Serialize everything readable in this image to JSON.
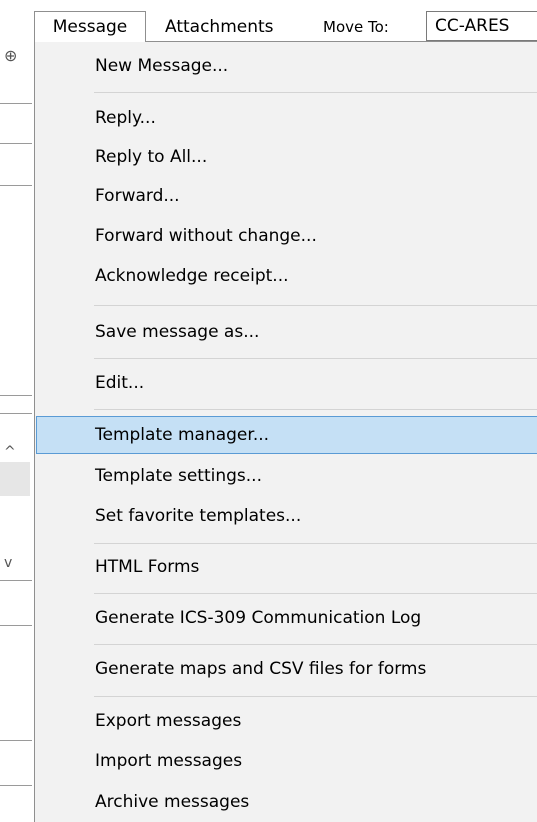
{
  "menubar": {
    "message_label": "Message",
    "attachments_label": "Attachments",
    "moveto_label": "Move To:",
    "folder_value": "CC-ARES"
  },
  "background": {
    "globe_icon": "globe-icon",
    "scroll_up_glyph": "^",
    "scroll_down_glyph": "v"
  },
  "menu": {
    "items": [
      {
        "label": "New Message..."
      },
      {
        "label": "Reply..."
      },
      {
        "label": "Reply to All..."
      },
      {
        "label": "Forward..."
      },
      {
        "label": "Forward without change..."
      },
      {
        "label": "Acknowledge receipt..."
      },
      {
        "label": "Save message as..."
      },
      {
        "label": "Edit..."
      },
      {
        "label": "Template manager..."
      },
      {
        "label": "Template settings..."
      },
      {
        "label": "Set favorite templates..."
      },
      {
        "label": "HTML Forms"
      },
      {
        "label": "Generate ICS-309 Communication Log"
      },
      {
        "label": "Generate maps and CSV files for forms"
      },
      {
        "label": "Export messages"
      },
      {
        "label": "Import messages"
      },
      {
        "label": "Archive messages"
      }
    ],
    "highlighted_index": 8,
    "highlight_color": "#c5e0f5",
    "highlight_border_color": "#5a9bd5"
  }
}
